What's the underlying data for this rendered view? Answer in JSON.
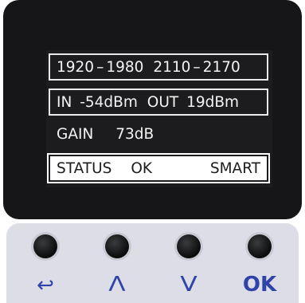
{
  "lcd": {
    "row1": {
      "a": "1920",
      "b": "1980",
      "c": "2110",
      "d": "2170"
    },
    "row2": {
      "in_label": "IN",
      "in_value": "-54dBm",
      "out_label": "OUT",
      "out_value": "19dBm"
    },
    "row3": {
      "gain_label": "GAIN",
      "gain_value": "73dB"
    },
    "row4": {
      "status_label": "STATUS",
      "status_value": "OK",
      "mode": "SMART"
    }
  },
  "keypad": {
    "labels": {
      "back": "↩",
      "up": "Λ",
      "down": "V",
      "ok": "OK"
    }
  },
  "colors": {
    "bezel": "#161618",
    "lcd_text": "#f3f3f3",
    "key_label": "#2f43a8",
    "keypad_bg": "#dcdde6"
  }
}
